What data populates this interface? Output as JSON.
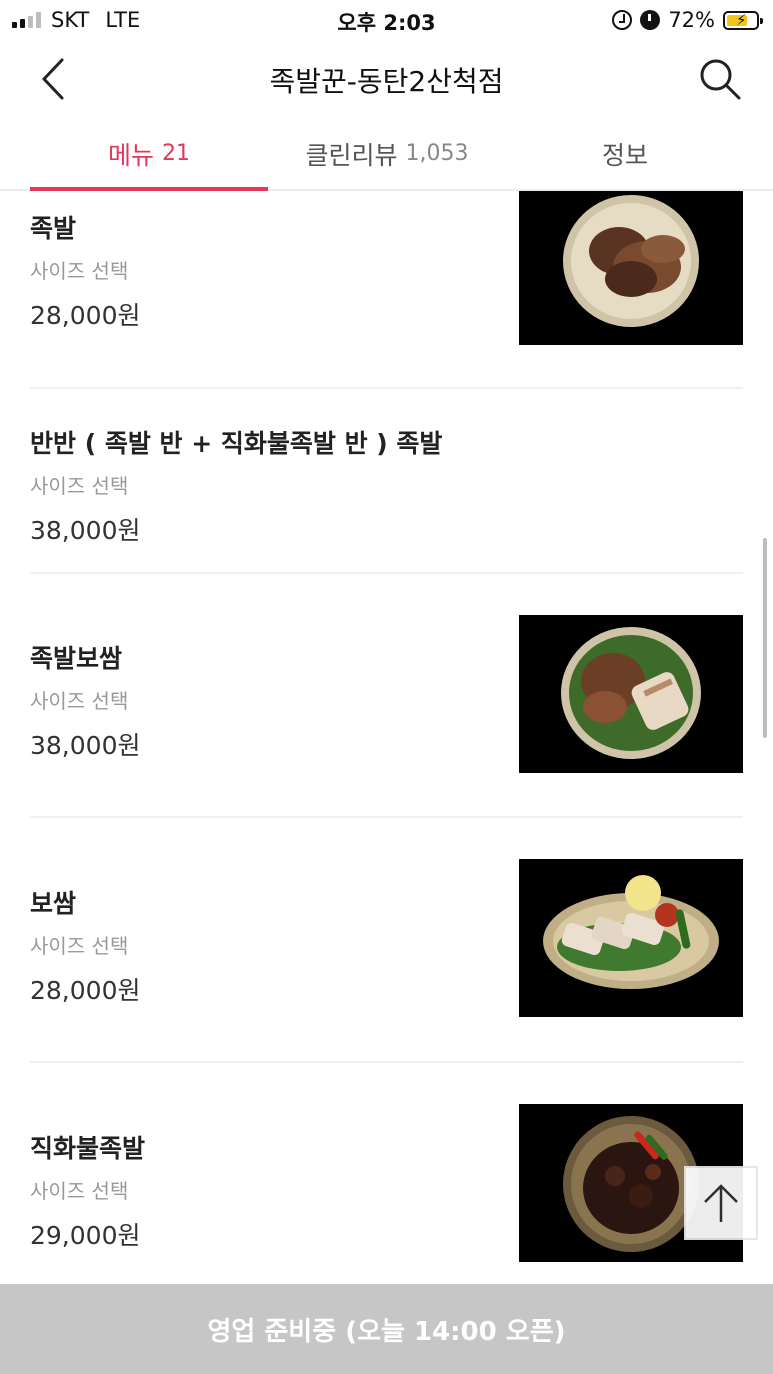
{
  "status_bar": {
    "carrier": "SKT",
    "network": "LTE",
    "time": "오후 2:03",
    "battery": "72%",
    "battery_level": 0.72,
    "icons": [
      "signal-icon",
      "rotation-lock-icon",
      "alarm-icon",
      "battery-charging-icon"
    ]
  },
  "header": {
    "title": "족발꾼-동탄2산척점",
    "back_icon": "back-arrow-icon",
    "search_icon": "search-icon"
  },
  "tabs": [
    {
      "label": "메뉴",
      "count": "21",
      "active": true
    },
    {
      "label": "클린리뷰",
      "count": "1,053",
      "active": false
    },
    {
      "label": "정보",
      "count": "",
      "active": false
    }
  ],
  "menu_items": [
    {
      "name": "족발",
      "option": "사이즈 선택",
      "price": "28,000원",
      "has_image": true
    },
    {
      "name": "반반 ( 족발 반 + 직화불족발 반 ) 족발",
      "option": "사이즈 선택",
      "price": "38,000원",
      "has_image": false
    },
    {
      "name": "족발보쌈",
      "option": "사이즈 선택",
      "price": "38,000원",
      "has_image": true
    },
    {
      "name": "보쌈",
      "option": "사이즈 선택",
      "price": "28,000원",
      "has_image": true
    },
    {
      "name": "직화불족발",
      "option": "사이즈 선택",
      "price": "29,000원",
      "has_image": true
    }
  ],
  "scroll_top_icon": "arrow-up-icon",
  "bottom_bar": {
    "label": "영업 준비중 (오늘 14:00 오픈)"
  },
  "colors": {
    "accent": "#e3385b",
    "bottom_bar": "#c6c6c6",
    "divider": "#f0f0f0"
  }
}
